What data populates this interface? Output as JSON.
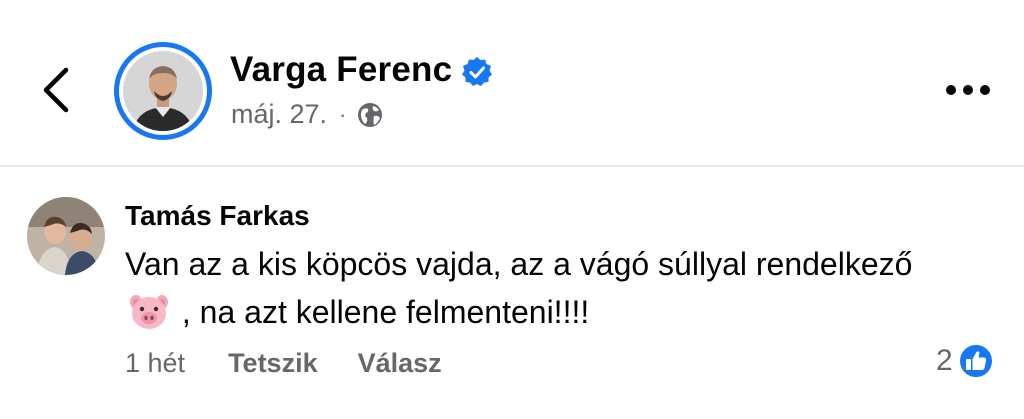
{
  "post": {
    "author_name": "Varga Ferenc",
    "date": "máj. 27.",
    "separator": "·",
    "privacy_icon": "globe-icon",
    "verified_icon": "verified-badge-icon"
  },
  "comment": {
    "author_name": "Tamás Farkas",
    "text_before_emoji": "Van az a kis köpcös vajda, az a vágó súllyal rendelkező",
    "emoji": "pig-face-emoji",
    "text_after_emoji": ", na azt kellene felmenteni!!!!",
    "time": "1 hét",
    "like_label": "Tetszik",
    "reply_label": "Válasz",
    "reaction_count": "2",
    "reaction_icon": "like-icon"
  },
  "colors": {
    "accent": "#1877f2",
    "secondary_text": "#65676b",
    "primary_text": "#050505",
    "divider": "#e4e6eb"
  }
}
